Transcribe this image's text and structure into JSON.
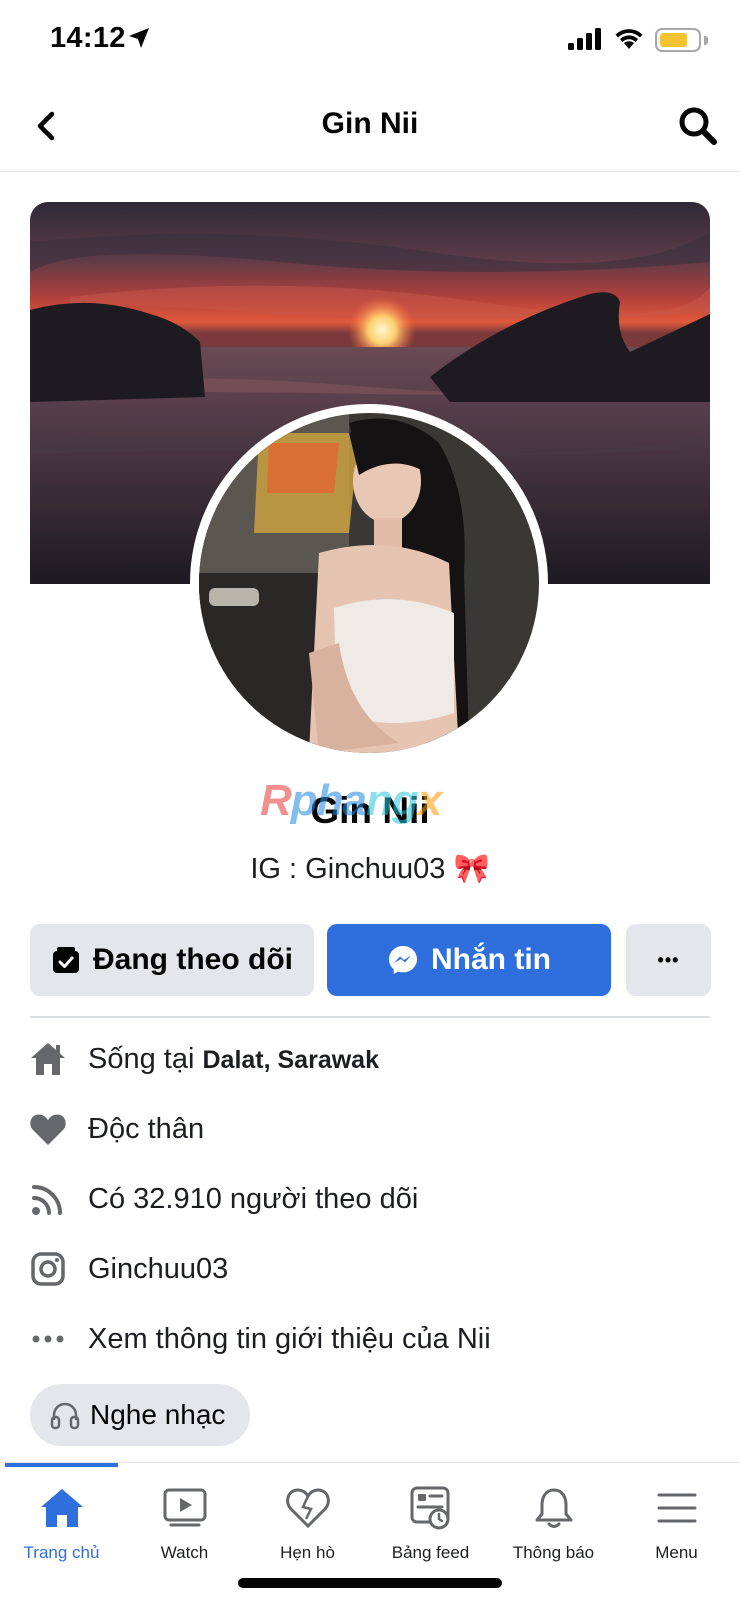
{
  "status_bar": {
    "time": "14:12",
    "battery_level": 0.75,
    "battery_color": "#f4c430"
  },
  "header": {
    "title": "Gin Nii"
  },
  "profile": {
    "name": "Gin Nii",
    "bio": "IG : Ginchuu03 🎀",
    "watermark": {
      "part1": "R",
      "part2": "pha",
      "part3": "ng",
      "part4": "x"
    }
  },
  "actions": {
    "following_label": "Đang theo dõi",
    "message_label": "Nhắn tin",
    "more_label": "•••"
  },
  "intro": {
    "lives_prefix": "Sống tại",
    "lives_place": "Dalat, Sarawak",
    "relationship": "Độc thân",
    "followers": "Có 32.910 người theo dõi",
    "instagram": "Ginchuu03",
    "see_about": "Xem thông tin giới thiệu của Nii"
  },
  "music_button": {
    "label": "Nghe nhạc"
  },
  "tabs": [
    {
      "label": "Trang chủ",
      "icon": "home-icon",
      "active": true
    },
    {
      "label": "Watch",
      "icon": "watch-icon",
      "active": false
    },
    {
      "label": "Hẹn hò",
      "icon": "dating-heart-icon",
      "active": false
    },
    {
      "label": "Bảng feed",
      "icon": "feed-icon",
      "active": false
    },
    {
      "label": "Thông báo",
      "icon": "bell-icon",
      "active": false
    },
    {
      "label": "Menu",
      "icon": "menu-icon",
      "active": false
    }
  ],
  "colors": {
    "accent": "#2f6fdd",
    "button_gray": "#e4e6eb",
    "icon_gray": "#65676b"
  }
}
